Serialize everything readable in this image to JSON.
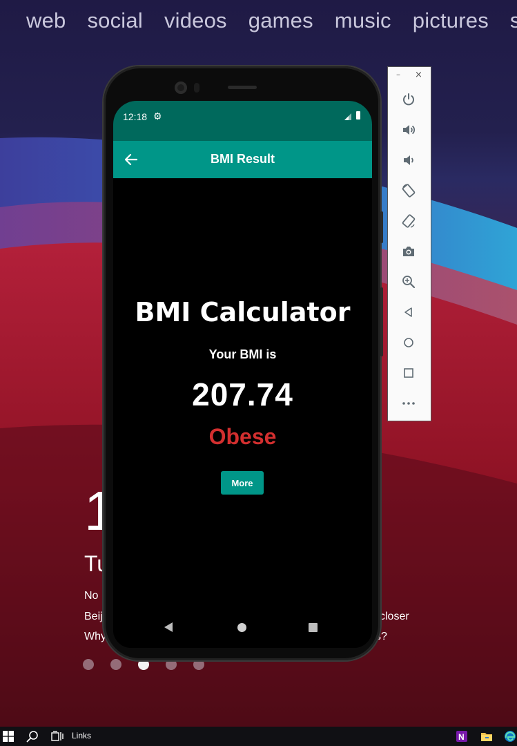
{
  "desktop": {
    "nav_tabs": [
      "web",
      "social",
      "videos",
      "games",
      "music",
      "pictures",
      "s"
    ],
    "news": {
      "big_number": "1",
      "headline_start": "Tu",
      "lines": [
        "No",
        "Beij",
        "Why"
      ],
      "right_fragments": [
        "closer",
        "s?"
      ]
    },
    "carousel": {
      "count": 5,
      "active_index": 2
    }
  },
  "phone": {
    "status_bar": {
      "time": "12:18",
      "settings_icon": "gear-icon",
      "signal_icon": "signal-icon",
      "battery_icon": "battery-icon"
    },
    "app_bar": {
      "title": "BMI Result",
      "back_icon": "arrow-back-icon"
    },
    "content": {
      "heading": "BMI Calculator",
      "bmi_label": "Your BMI is",
      "bmi_value": "207.74",
      "category": "Obese",
      "more_button": "More"
    },
    "nav_bar": {
      "back": "nav-back-icon",
      "home": "nav-home-icon",
      "recents": "nav-recents-icon"
    },
    "colors": {
      "status_bar": "#00695c",
      "app_bar": "#009688",
      "category": "#d32f2f",
      "button": "#009688"
    }
  },
  "emulator_toolbar": {
    "window_controls": {
      "minimize": "–",
      "close": "×"
    },
    "tools": [
      "power-icon",
      "volume-up-icon",
      "volume-down-icon",
      "rotate-left-icon",
      "rotate-right-icon",
      "camera-icon",
      "zoom-icon",
      "back-icon",
      "home-icon",
      "overview-icon",
      "more-icon"
    ]
  },
  "taskbar": {
    "links_label": "Links",
    "icons": [
      "windows-start-icon",
      "search-icon",
      "task-view-icon",
      "onenote-icon",
      "file-explorer-icon",
      "edge-icon"
    ]
  }
}
